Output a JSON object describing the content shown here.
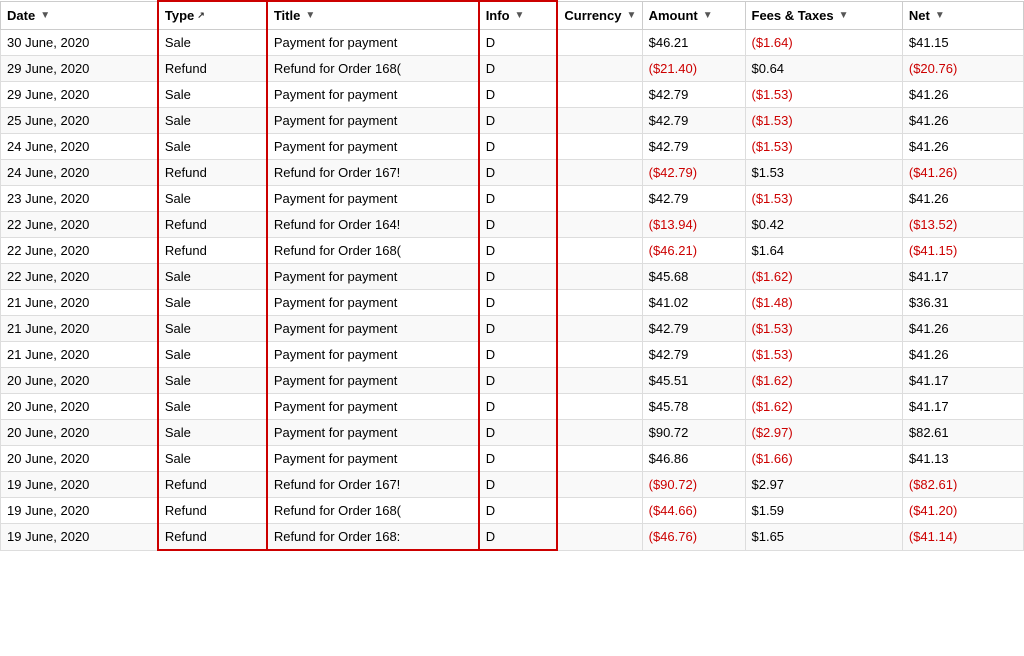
{
  "columns": [
    {
      "key": "date",
      "label": "Date",
      "hasFilter": true,
      "hasSort": false,
      "redBorder": false
    },
    {
      "key": "type",
      "label": "Type",
      "hasFilter": false,
      "hasSort": true,
      "redBorder": true
    },
    {
      "key": "title",
      "label": "Title",
      "hasFilter": true,
      "hasSort": false,
      "redBorder": true
    },
    {
      "key": "info",
      "label": "Info",
      "hasFilter": true,
      "hasSort": false,
      "redBorder": true
    },
    {
      "key": "currency",
      "label": "Currency",
      "hasFilter": true,
      "hasSort": false,
      "redBorder": false
    },
    {
      "key": "amount",
      "label": "Amount",
      "hasFilter": true,
      "hasSort": false,
      "redBorder": false
    },
    {
      "key": "fees",
      "label": "Fees & Taxes",
      "hasFilter": true,
      "hasSort": false,
      "redBorder": false
    },
    {
      "key": "net",
      "label": "Net",
      "hasFilter": true,
      "hasSort": false,
      "redBorder": false
    }
  ],
  "rows": [
    {
      "date": "30 June, 2020",
      "type": "Sale",
      "title": "Payment for payment",
      "info": "D",
      "currency": "",
      "amount": "$46.21",
      "fees": "($1.64)",
      "fees_red": true,
      "net": "$41.15",
      "net_red": false,
      "amount_red": false
    },
    {
      "date": "29 June, 2020",
      "type": "Refund",
      "title": "Refund for Order 168(",
      "info": "D",
      "currency": "",
      "amount": "($21.40)",
      "fees": "$0.64",
      "fees_red": false,
      "net": "($20.76)",
      "net_red": true,
      "amount_red": true
    },
    {
      "date": "29 June, 2020",
      "type": "Sale",
      "title": "Payment for payment",
      "info": "D",
      "currency": "",
      "amount": "$42.79",
      "fees": "($1.53)",
      "fees_red": true,
      "net": "$41.26",
      "net_red": false,
      "amount_red": false
    },
    {
      "date": "25 June, 2020",
      "type": "Sale",
      "title": "Payment for payment",
      "info": "D",
      "currency": "",
      "amount": "$42.79",
      "fees": "($1.53)",
      "fees_red": true,
      "net": "$41.26",
      "net_red": false,
      "amount_red": false
    },
    {
      "date": "24 June, 2020",
      "type": "Sale",
      "title": "Payment for payment",
      "info": "D",
      "currency": "",
      "amount": "$42.79",
      "fees": "($1.53)",
      "fees_red": true,
      "net": "$41.26",
      "net_red": false,
      "amount_red": false
    },
    {
      "date": "24 June, 2020",
      "type": "Refund",
      "title": "Refund for Order 167!",
      "info": "D",
      "currency": "",
      "amount": "($42.79)",
      "fees": "$1.53",
      "fees_red": false,
      "net": "($41.26)",
      "net_red": true,
      "amount_red": true
    },
    {
      "date": "23 June, 2020",
      "type": "Sale",
      "title": "Payment for payment",
      "info": "D",
      "currency": "",
      "amount": "$42.79",
      "fees": "($1.53)",
      "fees_red": true,
      "net": "$41.26",
      "net_red": false,
      "amount_red": false
    },
    {
      "date": "22 June, 2020",
      "type": "Refund",
      "title": "Refund for Order 164!",
      "info": "D",
      "currency": "",
      "amount": "($13.94)",
      "fees": "$0.42",
      "fees_red": false,
      "net": "($13.52)",
      "net_red": true,
      "amount_red": true
    },
    {
      "date": "22 June, 2020",
      "type": "Refund",
      "title": "Refund for Order 168(",
      "info": "D",
      "currency": "",
      "amount": "($46.21)",
      "fees": "$1.64",
      "fees_red": false,
      "net": "($41.15)",
      "net_red": true,
      "amount_red": true
    },
    {
      "date": "22 June, 2020",
      "type": "Sale",
      "title": "Payment for payment",
      "info": "D",
      "currency": "",
      "amount": "$45.68",
      "fees": "($1.62)",
      "fees_red": true,
      "net": "$41.17",
      "net_red": false,
      "amount_red": false
    },
    {
      "date": "21 June, 2020",
      "type": "Sale",
      "title": "Payment for payment",
      "info": "D",
      "currency": "",
      "amount": "$41.02",
      "fees": "($1.48)",
      "fees_red": true,
      "net": "$36.31",
      "net_red": false,
      "amount_red": false
    },
    {
      "date": "21 June, 2020",
      "type": "Sale",
      "title": "Payment for payment",
      "info": "D",
      "currency": "",
      "amount": "$42.79",
      "fees": "($1.53)",
      "fees_red": true,
      "net": "$41.26",
      "net_red": false,
      "amount_red": false
    },
    {
      "date": "21 June, 2020",
      "type": "Sale",
      "title": "Payment for payment",
      "info": "D",
      "currency": "",
      "amount": "$42.79",
      "fees": "($1.53)",
      "fees_red": true,
      "net": "$41.26",
      "net_red": false,
      "amount_red": false
    },
    {
      "date": "20 June, 2020",
      "type": "Sale",
      "title": "Payment for payment",
      "info": "D",
      "currency": "",
      "amount": "$45.51",
      "fees": "($1.62)",
      "fees_red": true,
      "net": "$41.17",
      "net_red": false,
      "amount_red": false
    },
    {
      "date": "20 June, 2020",
      "type": "Sale",
      "title": "Payment for payment",
      "info": "D",
      "currency": "",
      "amount": "$45.78",
      "fees": "($1.62)",
      "fees_red": true,
      "net": "$41.17",
      "net_red": false,
      "amount_red": false
    },
    {
      "date": "20 June, 2020",
      "type": "Sale",
      "title": "Payment for payment",
      "info": "D",
      "currency": "",
      "amount": "$90.72",
      "fees": "($2.97)",
      "fees_red": true,
      "net": "$82.61",
      "net_red": false,
      "amount_red": false
    },
    {
      "date": "20 June, 2020",
      "type": "Sale",
      "title": "Payment for payment",
      "info": "D",
      "currency": "",
      "amount": "$46.86",
      "fees": "($1.66)",
      "fees_red": true,
      "net": "$41.13",
      "net_red": false,
      "amount_red": false
    },
    {
      "date": "19 June, 2020",
      "type": "Refund",
      "title": "Refund for Order 167!",
      "info": "D",
      "currency": "",
      "amount": "($90.72)",
      "fees": "$2.97",
      "fees_red": false,
      "net": "($82.61)",
      "net_red": true,
      "amount_red": true
    },
    {
      "date": "19 June, 2020",
      "type": "Refund",
      "title": "Refund for Order 168(",
      "info": "D",
      "currency": "",
      "amount": "($44.66)",
      "fees": "$1.59",
      "fees_red": false,
      "net": "($41.20)",
      "net_red": true,
      "amount_red": true
    },
    {
      "date": "19 June, 2020",
      "type": "Refund",
      "title": "Refund for Order 168:",
      "info": "D",
      "currency": "",
      "amount": "($46.76)",
      "fees": "$1.65",
      "fees_red": false,
      "net": "($41.14)",
      "net_red": true,
      "amount_red": true
    }
  ]
}
